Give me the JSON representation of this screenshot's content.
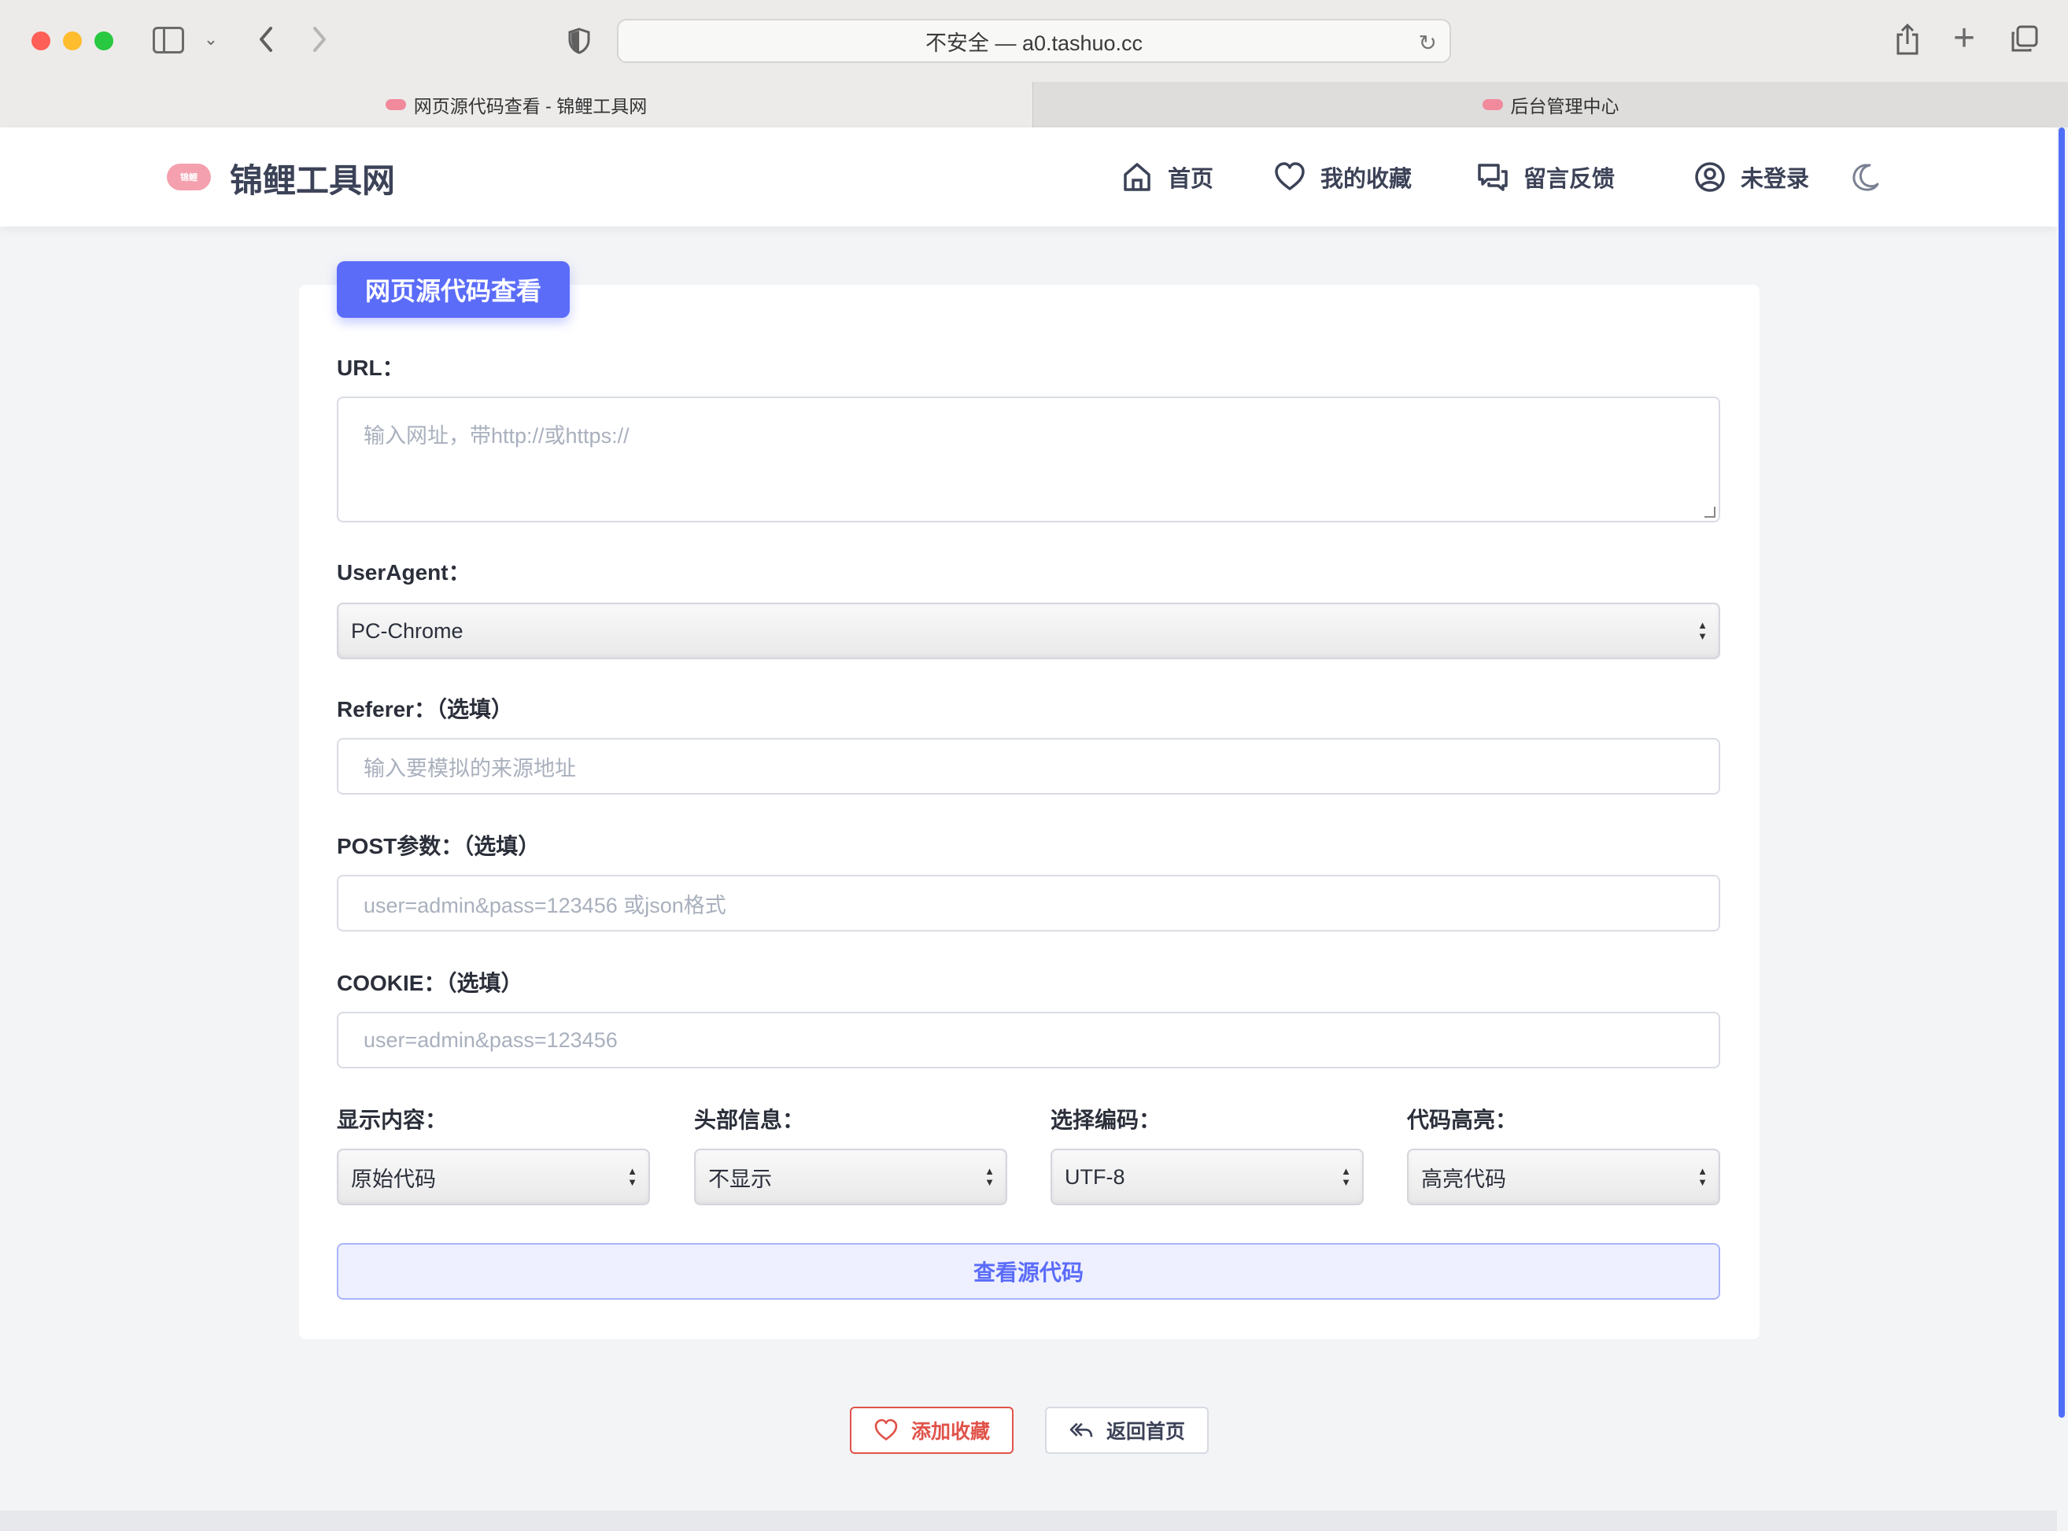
{
  "browser": {
    "address": "不安全 — a0.tashuo.cc",
    "tabs": [
      {
        "label": "网页源代码查看 - 锦鲤工具网",
        "active": true
      },
      {
        "label": "后台管理中心",
        "active": false
      }
    ]
  },
  "site": {
    "name": "锦鲤工具网",
    "nav": {
      "home": "首页",
      "favorites": "我的收藏",
      "feedback": "留言反馈",
      "login": "未登录"
    }
  },
  "form": {
    "title": "网页源代码查看",
    "url": {
      "label": "URL：",
      "placeholder": "输入网址，带http://或https://"
    },
    "useragent": {
      "label": "UserAgent：",
      "value": "PC-Chrome"
    },
    "referer": {
      "label": "Referer：（选填）",
      "placeholder": "输入要模拟的来源地址"
    },
    "post": {
      "label": "POST参数：（选填）",
      "placeholder": "user=admin&pass=123456 或json格式"
    },
    "cookie": {
      "label": "COOKIE：（选填）",
      "placeholder": "user=admin&pass=123456"
    },
    "display": {
      "label": "显示内容：",
      "value": "原始代码"
    },
    "headers": {
      "label": "头部信息：",
      "value": "不显示"
    },
    "encoding": {
      "label": "选择编码：",
      "value": "UTF-8"
    },
    "highlight": {
      "label": "代码高亮：",
      "value": "高亮代码"
    },
    "submit": "查看源代码"
  },
  "actions": {
    "add_favorite": "添加收藏",
    "back_home": "返回首页"
  },
  "colors": {
    "accent": "#5b6cf9",
    "danger": "#e0534a",
    "text": "#3c4257"
  }
}
